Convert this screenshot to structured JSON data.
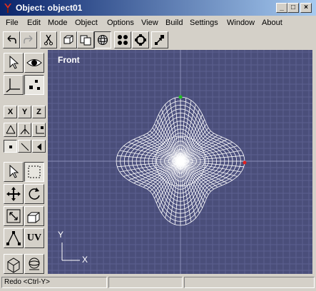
{
  "window": {
    "title": "Object: object01"
  },
  "menu": [
    "File",
    "Edit",
    "Mode",
    "Object",
    "Options",
    "View",
    "Build",
    "Settings",
    "Window",
    "About"
  ],
  "toolbar": {
    "items": [
      "undo-icon",
      "redo-icon",
      "cut-icon",
      "cube-icon",
      "copy-icon",
      "sphere-icon",
      "grid4-icon",
      "rotate-icon",
      "snap-icon"
    ]
  },
  "left_toolbar": {
    "axis_buttons": [
      "X",
      "Y",
      "Z"
    ],
    "uv_label": "UV"
  },
  "viewport": {
    "label": "Front",
    "axis_y": "Y",
    "axis_x": "X"
  },
  "status": {
    "text": "Redo  <Ctrl-Y>"
  },
  "colors": {
    "title_start": "#0a246a",
    "viewport_bg": "#4a4e7a",
    "grid": "#5c6090",
    "mesh": "#ffffff"
  }
}
